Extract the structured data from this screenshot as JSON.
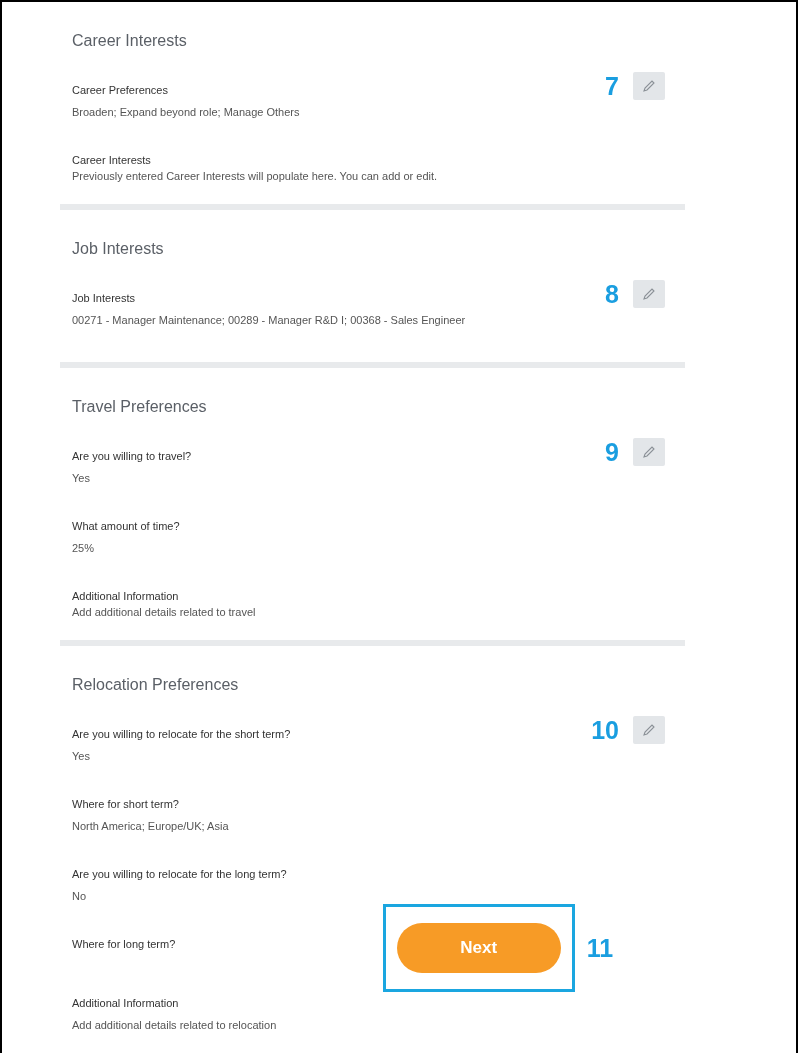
{
  "sections": [
    {
      "title": "Career Interests",
      "callout": "7",
      "fields": [
        {
          "label": "Career Preferences",
          "value": "Broaden; Expand beyond role; Manage Others"
        },
        {
          "label": "Career Interests",
          "value": "Previously entered Career Interests will populate here. You can add or edit.",
          "kind": "tight"
        }
      ]
    },
    {
      "title": "Job Interests",
      "callout": "8",
      "fields": [
        {
          "label": "Job Interests",
          "value": "00271 - Manager Maintenance; 00289 - Manager R&D I; 00368 - Sales Engineer"
        }
      ]
    },
    {
      "title": "Travel Preferences",
      "callout": "9",
      "fields": [
        {
          "label": "Are you willing to travel?",
          "value": "Yes"
        },
        {
          "label": "What amount of time?",
          "value": "25%"
        },
        {
          "label": "Additional Information",
          "value": "Add additional details related to travel",
          "kind": "tight"
        }
      ]
    },
    {
      "title": "Relocation Preferences",
      "callout": "10",
      "fields": [
        {
          "label": "Are you willing to relocate for the short term?",
          "value": "Yes"
        },
        {
          "label": "Where for short term?",
          "value": "North America; Europe/UK; Asia"
        },
        {
          "label": "Are you willing to relocate for the long term?",
          "value": "No"
        },
        {
          "label": "Where for long term?",
          "kind": "with_next"
        },
        {
          "label": "Additional Information",
          "value": "Add additional details related to relocation"
        }
      ]
    }
  ],
  "next_button": {
    "label": "Next",
    "callout": "11"
  }
}
